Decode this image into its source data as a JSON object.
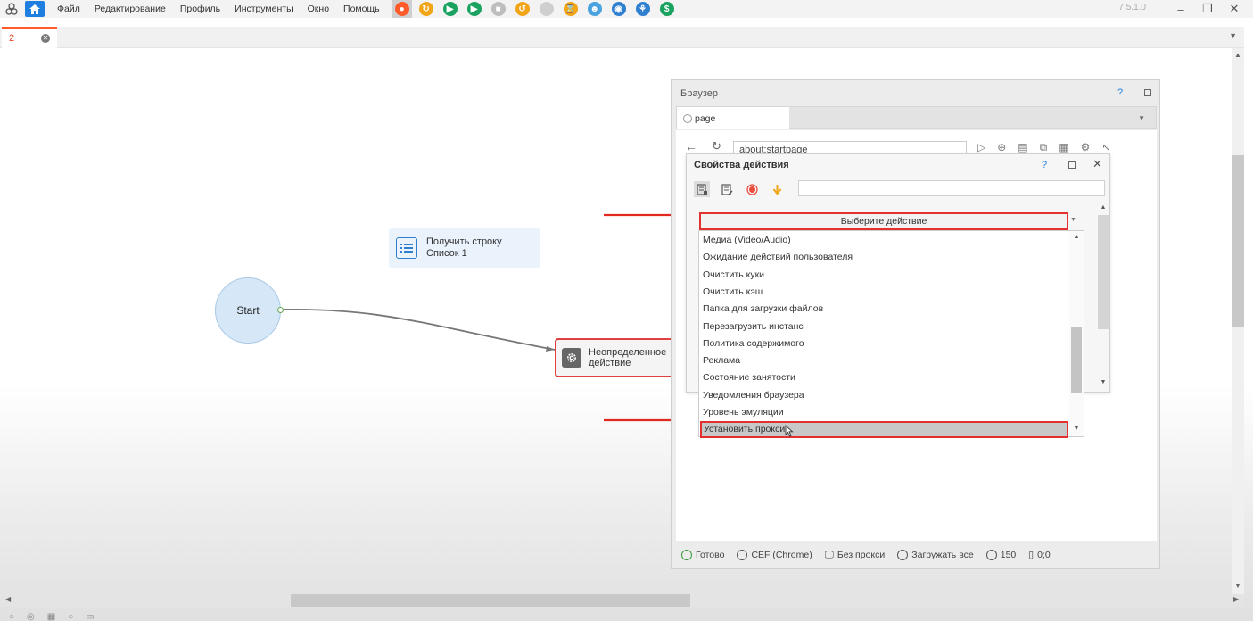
{
  "app": {
    "version": "7.5.1.0",
    "menu": [
      "Файл",
      "Редактирование",
      "Профиль",
      "Инструменты",
      "Окно",
      "Помощь"
    ],
    "toolbar_icons": [
      {
        "name": "record-icon",
        "color": "#ff5a2a",
        "glyph": "●"
      },
      {
        "name": "refresh-icon",
        "color": "#f2a516",
        "glyph": "↻"
      },
      {
        "name": "play-icon",
        "color": "#1aa260",
        "glyph": "▶"
      },
      {
        "name": "step-icon",
        "color": "#1aa260",
        "glyph": "▶"
      },
      {
        "name": "stop-icon",
        "color": "#bdbdbd",
        "glyph": "■"
      },
      {
        "name": "undo-icon",
        "color": "#f2a516",
        "glyph": "↺"
      },
      {
        "name": "circle-icon",
        "color": "#cfcfcf",
        "glyph": ""
      },
      {
        "name": "hourglass-icon",
        "color": "#f2a516",
        "glyph": "⌛"
      },
      {
        "name": "user-icon",
        "color": "#4aa3df",
        "glyph": "☻"
      },
      {
        "name": "eye-icon",
        "color": "#2f7fd1",
        "glyph": "◉"
      },
      {
        "name": "network-icon",
        "color": "#2f7fd1",
        "glyph": "⚘"
      },
      {
        "name": "dollar-icon",
        "color": "#1aa260",
        "glyph": "$"
      }
    ]
  },
  "tabs": {
    "active_tab": "2"
  },
  "canvas": {
    "start_node": "Start",
    "list_node": {
      "line1": "Получить строку",
      "line2": "Список 1"
    },
    "action_node": {
      "line1": "Неопределенное",
      "line2": "действие"
    }
  },
  "browser": {
    "title": "Браузер",
    "help": "?",
    "tab_label": "page",
    "url": "about:startpage",
    "status": {
      "ready": "Готово",
      "engine": "CEF (Chrome)",
      "proxy": "Без прокси",
      "load": "Загружать все",
      "timeout": "150",
      "coords": "0;0"
    }
  },
  "action_props": {
    "title": "Свойства действия",
    "help": "?",
    "select_placeholder": "Выберите действие",
    "options": [
      "Медиа (Video/Audio)",
      "Ожидание действий пользователя",
      "Очистить куки",
      "Очистить кэш",
      "Папка для загрузки файлов",
      "Перезагрузить инстанс",
      "Политика содержимого",
      "Реклама",
      "Состояние занятости",
      "Уведомления браузера",
      "Уровень эмуляции",
      "Установить прокси"
    ],
    "selected_option": "Установить прокси"
  },
  "colors": {
    "accent": "#1f7fe0",
    "highlight": "#e03030",
    "tab_accent": "#ff5a2a"
  }
}
